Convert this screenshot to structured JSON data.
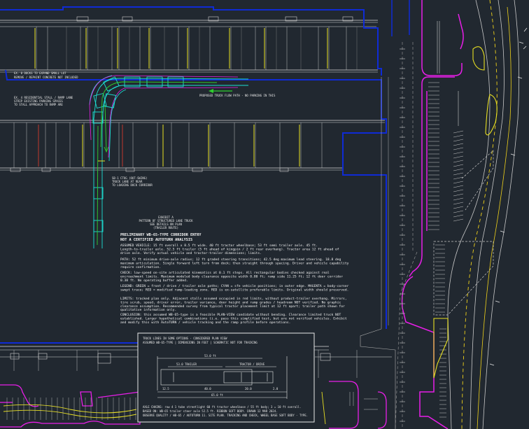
{
  "colors": {
    "background": "#212830",
    "wall": "#d8d8d8",
    "property_line": "#0f2bd6",
    "curb": "#e81ee8",
    "truck_path": "#1de0d4",
    "arrow": "#2fd12f",
    "door": "#e8e022",
    "dock": "#c0392b",
    "road_center": "#f0d21a"
  },
  "annotations": {
    "note_a_line1": "EX. 8 DOCKS TO EXPAND SMALL LOT",
    "note_a_line2": "REMOVE / REPAINT CONCRETE NOT INCLUDED",
    "note_b_line1": "EX. 4 RESIDENTIAL STALL / RAMP LANE",
    "note_b_line2": "STRIP EXISTING PARKING SPACES",
    "note_b_line3": "TO STALL APPROACH TO RAMP ARE",
    "flow_label": "PROPOSED TRUCK FLOW PATH - NO PARKING IN THIS",
    "label_c_1": "SB-1 CTOG (OUT-SWING)",
    "label_c_2": "TRUCK LANE AT REAR",
    "label_c_3": "TO LOADING DOCK CORRIDOR"
  },
  "tracking_title": {
    "line1": "EXHIBIT A",
    "line2": "PATTERN OF STRUCTURED LANE TRUCK",
    "line3": "SEE DETAILS ON PLAN",
    "line4": "(TRAILER ROUTE)"
  },
  "notes": {
    "heading1": "PRELIMINARY WB-65-TYPE CORRIDOR ENTRY",
    "heading2": "NOT A CERTIFIED AUTOTURN ANALYSIS",
    "p1": "ASSUMED VEHICLE: 15 ft overall x 8.5 ft wide. 40 ft tractor wheelbase; 53 ft semi trailer axle. 45 ft. Length-to-trailer axle. 52.5 ft trailer (5 ft ahead of kingpin / 2 ft rear overhang). Tractor area 12 ft ahead of drive axle. Verify actual vehicle and tractor-trailer dimensions; limits.",
    "p2": "PATH: 52 ft minimum drive-axle radius; 12 ft graded steering transitions; 42.5 deg maximum lead steering. 18.8 deg maximum articulation. Single forward left turn from dock; then straight through spacing. Driver and vehicle capability require confirmation.",
    "p3": "CHECK: low-speed on-site articulated kinematics at 0.1 ft steps. All rectangular bodies checked against real encroachment limits. Maximum modeled body clearance opposite width 0.80 ft; ramp side 11.25 ft; 12 ft door corridor 0.38 ft. No operating buffer added.",
    "p4": "LEGEND: GREEN = front / drive / trailer axle paths; CYAN = sfe vehicle positions; in outer edge. MAGENTA = body-corner swept trace; RED = modified ramp-loading zone. RED is ex-satellite preferable limits. Original width should preserved.",
    "p5": "LIMITS: tracked plan only. Adjacent stalls assumed occupied in red limits, without product-trailer overhang. Mirrors, tire scrub, speed, driver error, trailer variance, door height and ramp grades / headroom NOT verified. No graphic clearance assumption. Recommended survey from typical tractor placement limit at 12 ft apart; trailer path shown for qualitative information only.",
    "p6": "CONCLUSION: this assumed WB-65-type is a feasible PLAN-VIEW candidate without bending. Clearance limited truck NOT established. Larger hypothetical combinations (i.e. pass this simplified test, but are not verified vehicles. Exhibit and modify this with AutoTURN / vehicle tracking and the ramp profile before operations."
  },
  "inset": {
    "title": "TRUCK LINES IN SOME OPTIONS - CONSIDERED PLAN VIEW",
    "subtitle": "ASSUMED WB-65-TYPE | DIMENSIONS IN FEET | SCHEMATIC NOT FOR TRACKING",
    "dim_top": "53.0 ft",
    "dim_trailer": "53.0 TRAILER",
    "dim_tractor": "TRACTOR / DRIVE",
    "dim_bottom": "65.0 ft",
    "dim_mid_left": "12.5",
    "dim_mid_center": "40.0",
    "dim_mid_right": "20.0",
    "dim_mid_right2": "2.0",
    "footer1": "AXLE CHAINS: row 4 1 tube streetlight 60 ft tractor wheelbase / 55 ft body; 3 = 10 ft overall.",
    "footer2": "BASED ON: WB-65 trailer steer axle 52.5 ft. RIBBON SOFT BODY. DRAWN 12 MAR 2024.",
    "footer3": "OBSERVE QUALITY / WB-65 / AUTOTURN 11. SITE PLAN. TRACKING AND CHECK, WHEEL BASE SOFT BODY - TYPE."
  }
}
